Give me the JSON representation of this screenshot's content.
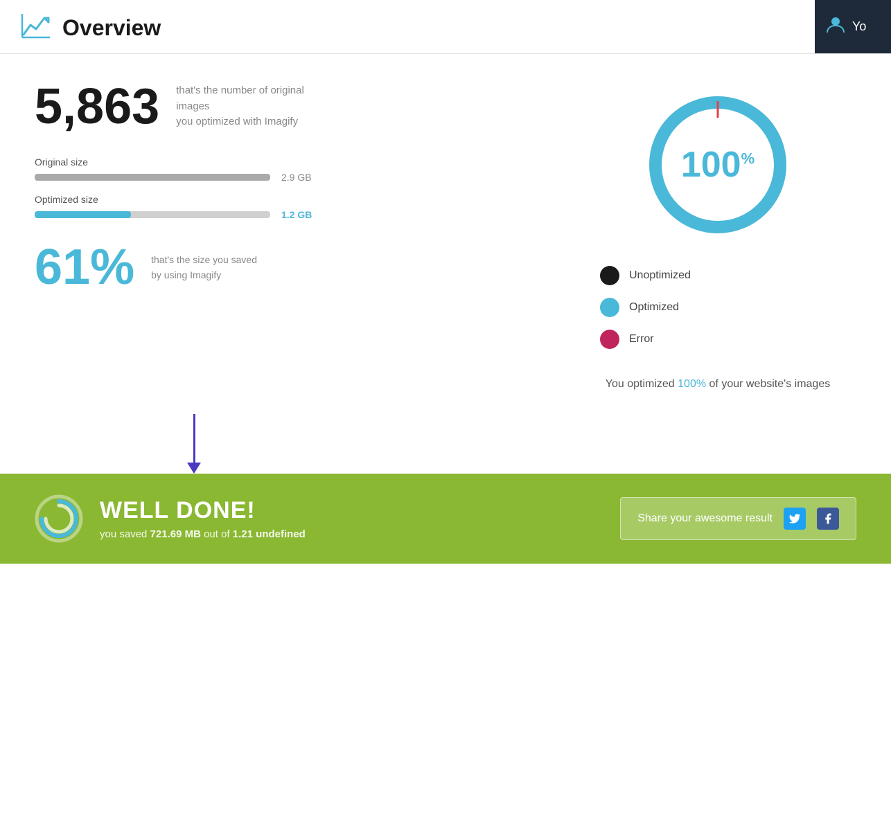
{
  "header": {
    "title": "Overview",
    "user_label": "Yo"
  },
  "stats": {
    "image_count": "5,863",
    "image_count_desc_line1": "that's the number of original images",
    "image_count_desc_line2": "you optimized with Imagify",
    "original_size_label": "Original size",
    "original_size_value": "2.9 GB",
    "optimized_size_label": "Optimized size",
    "optimized_size_value": "1.2 GB",
    "savings_percent": "61%",
    "savings_desc_line1": "that's the size you saved",
    "savings_desc_line2": "by using Imagify"
  },
  "donut": {
    "percent": "100",
    "percent_sign": "%"
  },
  "legend": {
    "unoptimized_label": "Unoptimized",
    "optimized_label": "Optimized",
    "error_label": "Error"
  },
  "optimized_text": {
    "prefix": "You optimized ",
    "highlight": "100%",
    "suffix": " of your\nwebsite's images"
  },
  "banner": {
    "title": "WELL DONE!",
    "subtitle_prefix": "you saved ",
    "savings_amount": "721.69 MB",
    "subtitle_middle": " out of ",
    "total_amount": "1.21 undefined",
    "share_text": "Share your awesome result"
  }
}
